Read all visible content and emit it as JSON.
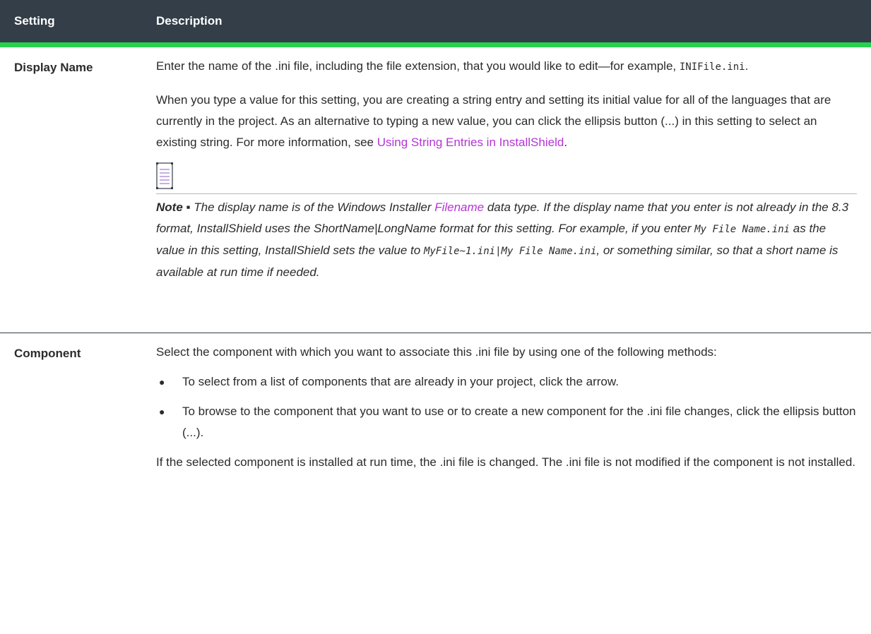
{
  "table": {
    "headers": [
      "Setting",
      "Description"
    ],
    "rows": [
      {
        "setting": "Display Name",
        "p1_text": "Enter the name of the .ini file, including the file extension, that you would like to edit—for example, ",
        "p1_code": "INIFile.ini",
        "p1_end": ".",
        "p2_text": "When you type a value for this setting, you are creating a string entry and setting its initial value for all of the languages that are currently in the project. As an alternative to typing a new value, you can click the ellipsis button (...) in this setting to select an existing string. For more information, see ",
        "p2_link": "Using String Entries in InstallShield",
        "p2_end": ".",
        "note": {
          "icon": "note-icon",
          "label": "Note ▪",
          "t1": " The display name is of the Windows Installer ",
          "link": "Filename",
          "t2": " data type. If the display name that you enter is not already in the 8.3 format, InstallShield uses the ShortName|LongName format for this setting. For example, if you enter ",
          "code1": "My File Name.ini",
          "t3": " as the value in this setting, InstallShield sets the value to ",
          "code2": "MyFile~1.ini|My File Name.ini",
          "t4": ", or something similar, so that a short name is available at run time if needed."
        }
      },
      {
        "setting": "Component",
        "p1": "Select the component with which you want to associate this .ini file by using one of the following methods:",
        "bullets": [
          "To select from a list of components that are already in your project, click the arrow.",
          "To browse to the component that you want to use or to create a new component for the .ini file changes, click the ellipsis button (...)."
        ],
        "p2": "If the selected component is installed at run time, the .ini file is changed. The .ini file is not modified if the component is not installed."
      }
    ]
  },
  "colors": {
    "header_bg": "#333e48",
    "header_accent": "#26d14f",
    "link": "#b534d6"
  }
}
